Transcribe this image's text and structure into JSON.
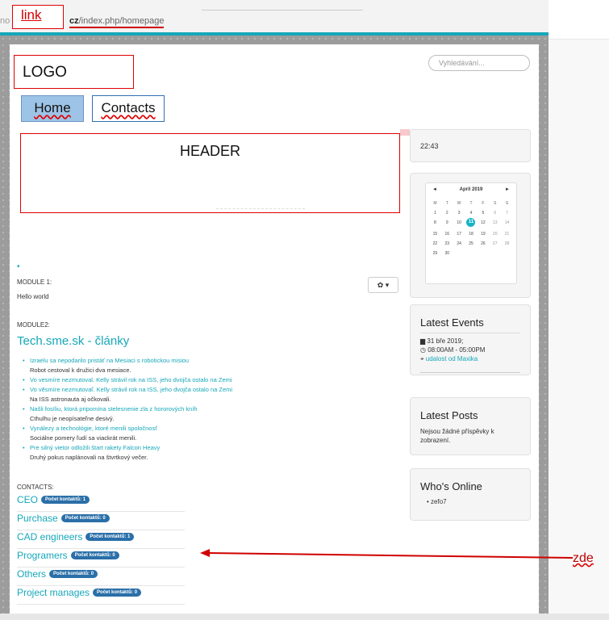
{
  "browser": {
    "url_ghost": "no",
    "url_host": "cz",
    "url_path": "/index.php/homepage"
  },
  "annotations": {
    "link_label": "link",
    "logo_label": "LOGO",
    "header_label": "HEADER",
    "pointer_label": "zde",
    "annotation_color": "#d00000"
  },
  "nav": {
    "items": [
      {
        "label": "Home",
        "active": true
      },
      {
        "label": "Contacts",
        "active": false
      }
    ]
  },
  "search": {
    "placeholder": "Vyhledávání..."
  },
  "sidebar": {
    "time": "22:43",
    "calendar": {
      "month": "April 2019",
      "prev": "◄",
      "next": "►",
      "days_of_week": [
        "M",
        "T",
        "W",
        "T",
        "F",
        "S",
        "S"
      ],
      "weeks": [
        [
          "1",
          "2",
          "3",
          "4",
          "5",
          "6",
          "7"
        ],
        [
          "8",
          "9",
          "10",
          "11",
          "12",
          "13",
          "14"
        ],
        [
          "15",
          "16",
          "17",
          "18",
          "19",
          "20",
          "21"
        ],
        [
          "22",
          "23",
          "24",
          "25",
          "26",
          "27",
          "28"
        ],
        [
          "29",
          "30",
          "",
          "",
          "",
          "",
          ""
        ]
      ],
      "today": "11"
    },
    "events": {
      "title": "Latest Events",
      "date": "31 bře 2019;",
      "time": "08:00AM - 05:00PM",
      "link": "udalost od Maxika"
    },
    "posts": {
      "title": "Latest Posts",
      "text": "Nejsou žádné příspěvky k zobrazení."
    },
    "online": {
      "title": "Who's Online",
      "users": [
        "zefo7"
      ]
    }
  },
  "main": {
    "module1": {
      "label": "MODULE 1:",
      "text": "Hello world"
    },
    "module2": {
      "label": "MODULE2:",
      "title": "Tech.sme.sk - články",
      "items": [
        {
          "link": "Izraelu sa nepodarilo pristáť na Mesiaci s robotickou misiou",
          "desc": "Robot cestoval k družici dva mesiace."
        },
        {
          "link": "Vo vesmíre nezmutoval. Kelly strávil rok na ISS, jeho dvojča ostalo na Zemi",
          "desc": ""
        },
        {
          "link": "Vo věsmíre nezmutovaľ. Kelly strávil rok na ISS, jeho dvojča ostalo na Zemi",
          "desc": "Na ISS astronauta aj očkovali."
        },
        {
          "link": "Našli fosíliu, ktorá pripomína stelesnenie zla z hororových kníh",
          "desc": "Cthulhu je neopísateľne desivý."
        },
        {
          "link": "Vynálezy a technológie, ktoré menili spoločnosť",
          "desc": "Sociálne pomery ľudí sa viackrát menili."
        },
        {
          "link": "Pre silný vietor odložili štart rakety Falcon Heavy",
          "desc": "Druhý pokus naplánovali na štvrtkový večer."
        }
      ]
    },
    "contacts": {
      "label": "CONTACTS:",
      "groups": [
        {
          "name": "CEO",
          "badge": "Počet kontaktů: 1"
        },
        {
          "name": "Purchase",
          "badge": "Počet kontaktů: 0"
        },
        {
          "name": "CAD engineers",
          "badge": "Počet kontaktů: 1"
        },
        {
          "name": "Programers",
          "badge": "Počet kontaktů: 0"
        },
        {
          "name": "Others",
          "badge": "Počet kontaktů: 0"
        },
        {
          "name": "Project manages",
          "badge": "Počet kontaktů: 0"
        }
      ]
    }
  },
  "icons": {
    "gear": "gear-icon",
    "caret": "caret-down-icon",
    "calendar": "calendar-icon",
    "clock": "clock-icon",
    "pin": "pin-icon"
  },
  "colors": {
    "accent": "#16a7b9",
    "badge": "#2a6fa8",
    "nav_active": "#9dc3e6"
  }
}
